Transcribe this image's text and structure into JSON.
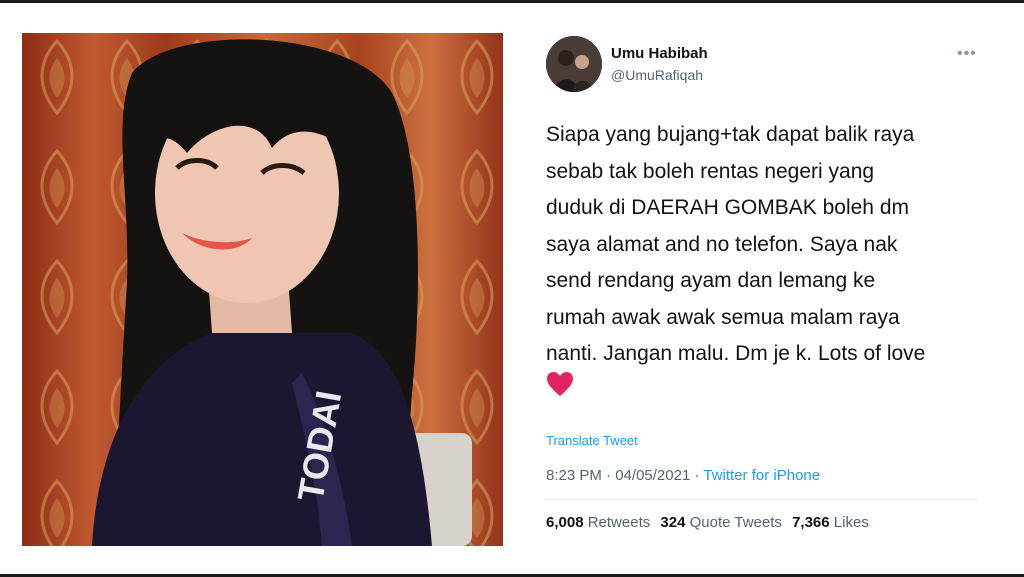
{
  "tweet": {
    "display_name": "Umu Habibah",
    "handle": "@UmuRafiqah",
    "more_icon": "more-horizontal-icon",
    "body_lines": [
      "Siapa yang bujang+tak dapat balik raya",
      "sebab tak boleh rentas negeri yang",
      "duduk di DAERAH GOMBAK boleh dm",
      "saya alamat and no telefon. Saya nak",
      "send rendang ayam dan lemang ke",
      "rumah awak awak semua malam raya",
      "nanti. Jangan malu. Dm je k. Lots of love"
    ],
    "emoji": "red-heart-icon",
    "translate_label": "Translate Tweet",
    "time": "8:23 PM",
    "separator": "·",
    "date": "04/05/2021",
    "source": "Twitter for iPhone",
    "stats": {
      "retweets_count": "6,008",
      "retweets_label": "Retweets",
      "quotes_count": "324",
      "quotes_label": "Quote Tweets",
      "likes_count": "7,366",
      "likes_label": "Likes"
    }
  },
  "colors": {
    "link_blue": "#1d9bf0",
    "text_primary": "#0f1419",
    "text_secondary": "#536471",
    "heart_red": "#e0245e"
  }
}
